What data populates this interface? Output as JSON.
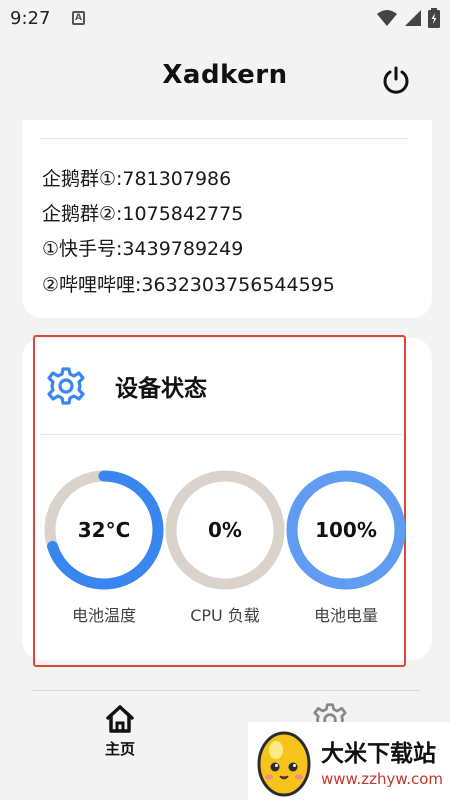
{
  "status_bar": {
    "time": "9:27",
    "notification_letter": "A",
    "icons": [
      "wifi-icon",
      "signal-icon",
      "battery-icon"
    ]
  },
  "header": {
    "title": "Xadkern",
    "power_icon": "power-icon"
  },
  "info_card": {
    "lines": [
      "企鹅群①:781307986",
      "企鹅群②:1075842775",
      "①快手号:3439789249",
      "②哔哩哔哩:3632303756544595"
    ]
  },
  "device_status": {
    "title": "设备状态",
    "icon": "gear-icon",
    "gauges": [
      {
        "value": "32°C",
        "label": "电池温度",
        "fraction": 0.7,
        "color": "#3a86f0"
      },
      {
        "value": "0%",
        "label": "CPU 负载",
        "fraction": 0.0,
        "color": "#3a86f0"
      },
      {
        "value": "100%",
        "label": "电池电量",
        "fraction": 1.0,
        "color": "#5f9cf2"
      }
    ],
    "track_color": "#d9d3cb"
  },
  "bottom_nav": {
    "home_label": "主页",
    "home_icon": "home-icon",
    "settings_icon": "settings-gear-icon"
  },
  "watermark": {
    "title": "大米下载站",
    "url": "www.zzhyw.com"
  },
  "colors": {
    "highlight": "#d9493a",
    "accent": "#3a86f0"
  }
}
